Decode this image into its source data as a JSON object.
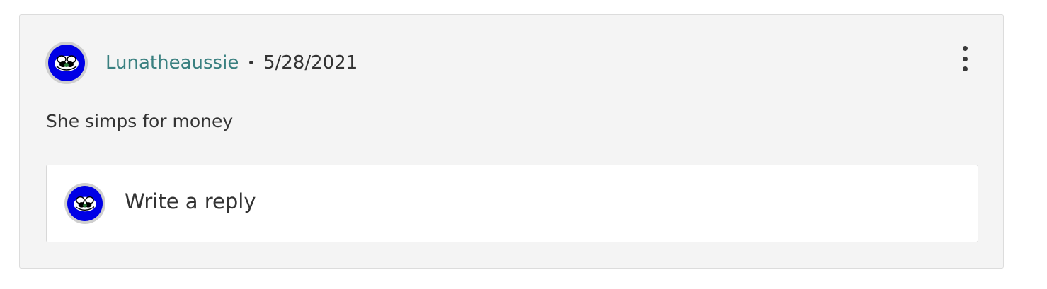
{
  "comment": {
    "username": "Lunatheaussie",
    "separator": "•",
    "date": "5/28/2021",
    "text": "She simps for money",
    "avatar_icon": "user-avatar-icon",
    "menu_icon": "more-vertical-icon"
  },
  "reply": {
    "placeholder": "Write a reply",
    "avatar_icon": "user-avatar-icon"
  },
  "colors": {
    "username": "#3a8080",
    "avatar_background": "#0000e6",
    "card_background": "#f4f4f4"
  }
}
